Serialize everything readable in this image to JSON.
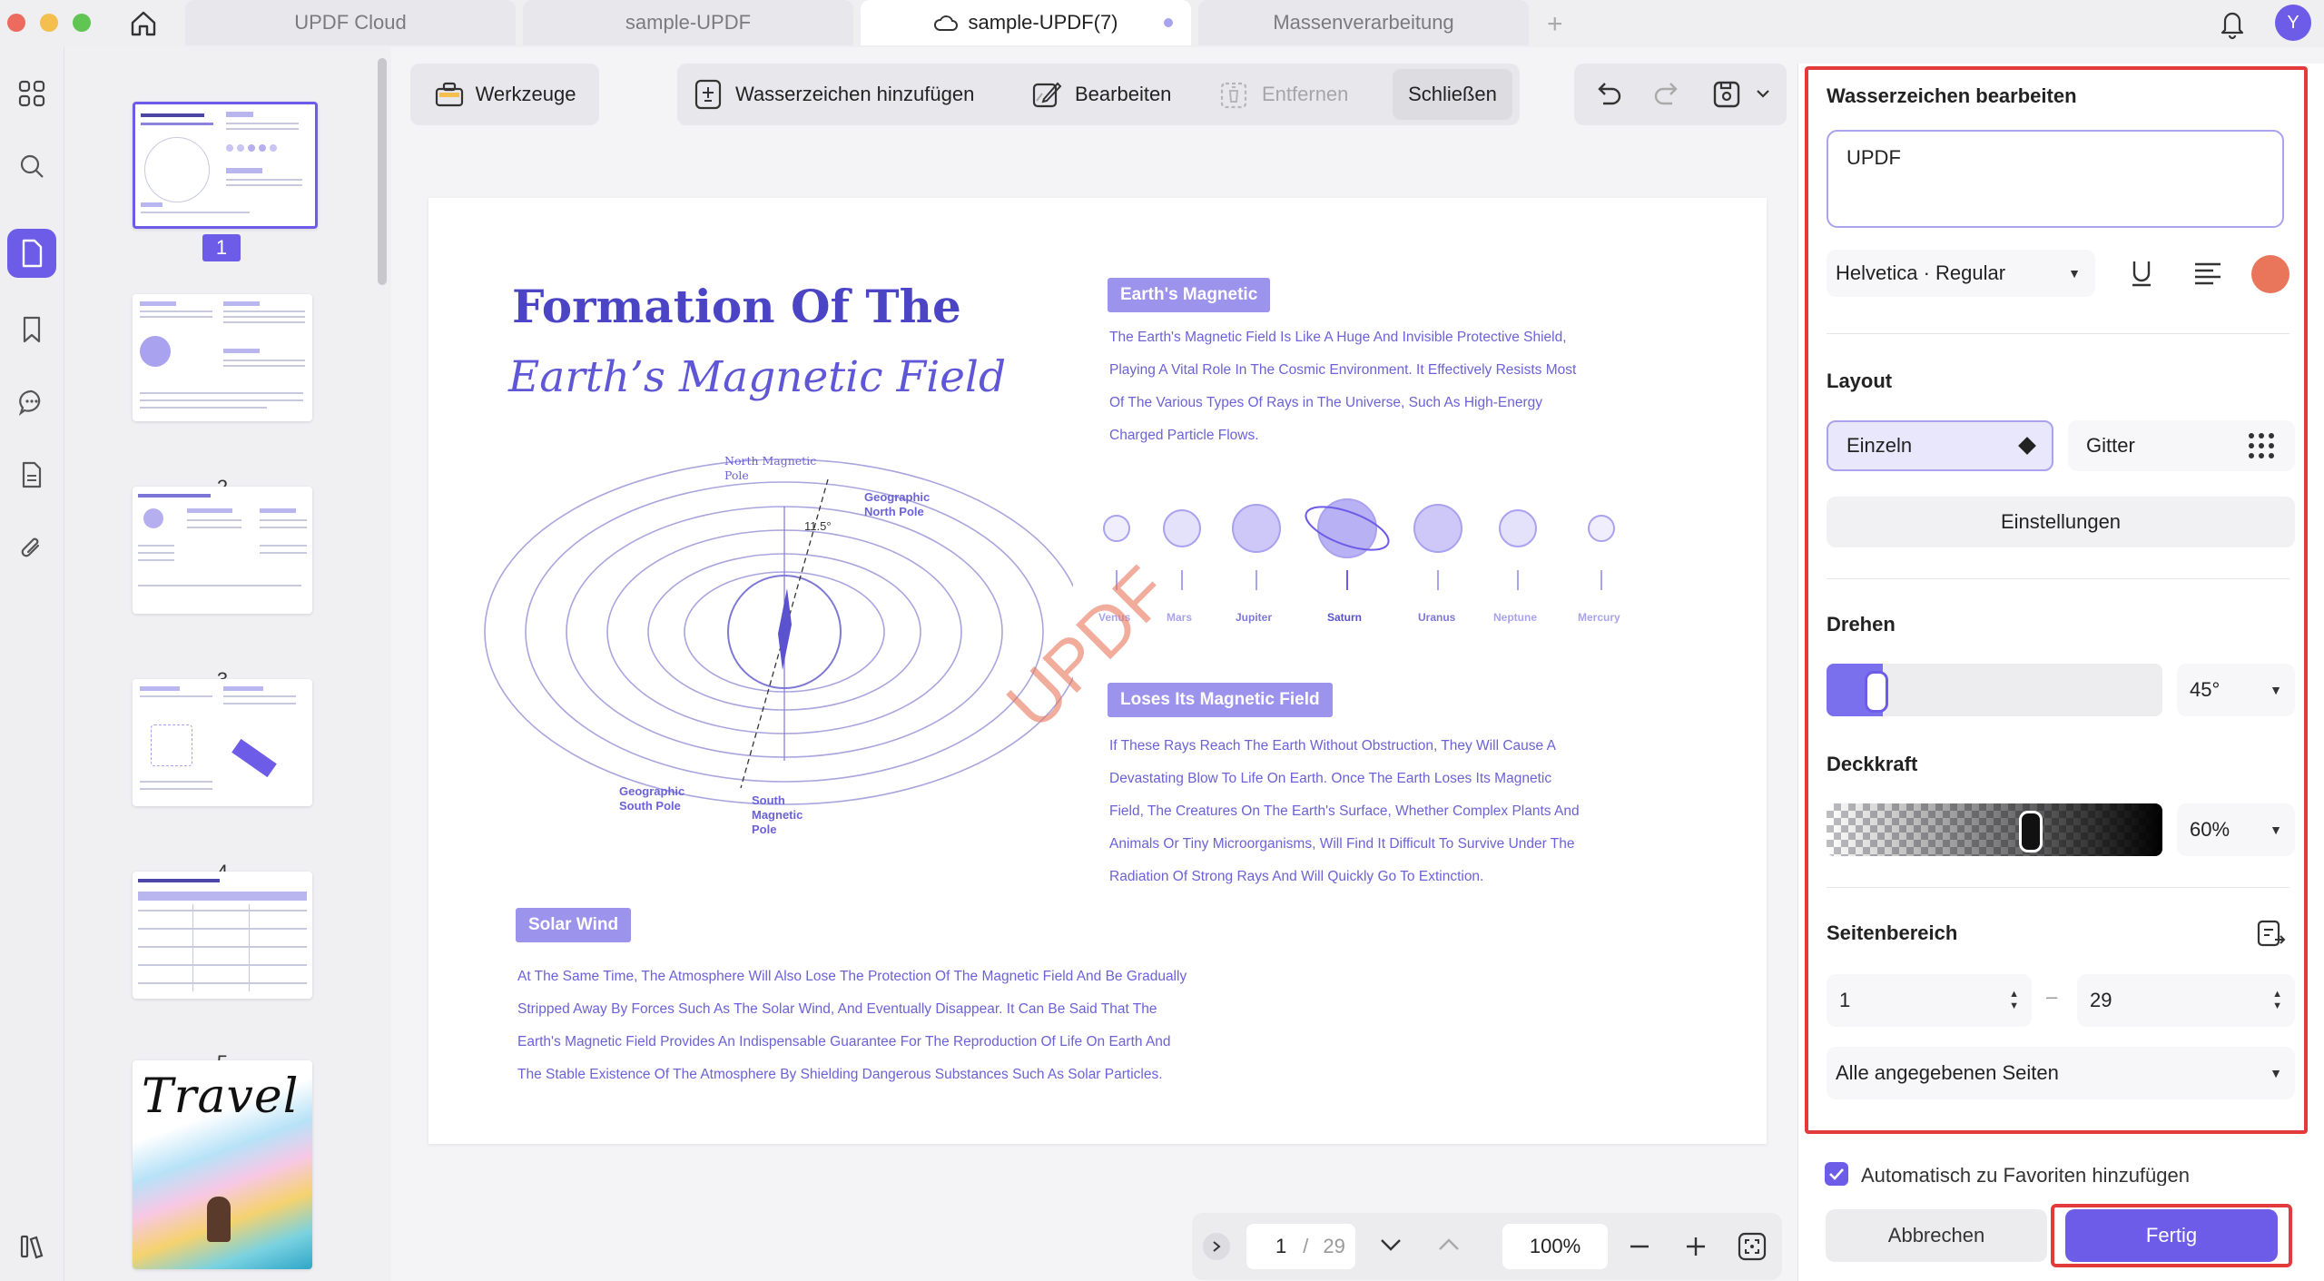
{
  "tabs": [
    {
      "label": "UPDF Cloud"
    },
    {
      "label": "sample-UPDF"
    },
    {
      "label": "sample-UPDF(7)"
    },
    {
      "label": "Massenverarbeitung"
    }
  ],
  "avatar_initial": "Y",
  "toolbar": {
    "werkzeuge": "Werkzeuge",
    "add_watermark": "Wasserzeichen hinzufügen",
    "edit": "Bearbeiten",
    "remove": "Entfernen",
    "close": "Schließen"
  },
  "thumbnails": {
    "page_numbers": [
      "1",
      "2",
      "3",
      "4",
      "5"
    ]
  },
  "document": {
    "title_line1": "Formation Of The",
    "title_line2": "Earth’s Magnetic Field",
    "section1_heading": "Earth's Magnetic",
    "section1_lines": [
      "The Earth's Magnetic Field Is Like A Huge And Invisible Protective Shield,",
      "Playing A Vital Role In The Cosmic Environment. It Effectively Resists Most",
      "Of The Various Types Of Rays in The Universe, Such As High-Energy",
      "Charged Particle Flows."
    ],
    "planets": [
      "Venus",
      "Mars",
      "Jupiter",
      "Saturn",
      "Uranus",
      "Neptune",
      "Mercury"
    ],
    "diagram_labels": {
      "north_magnetic": "North Magnetic Pole",
      "geo_north": "Geographic North Pole",
      "geo_south": "Geographic South Pole",
      "south_magnetic": "South Magnetic Pole",
      "angle": "11.5°"
    },
    "section2_heading": "Loses Its Magnetic Field",
    "section2_lines": [
      "If These Rays Reach The Earth Without Obstruction, They Will Cause A",
      "Devastating Blow To Life On Earth. Once The Earth Loses Its Magnetic",
      "Field, The Creatures On The Earth's Surface, Whether Complex Plants And",
      "Animals Or Tiny Microorganisms, Will Find It Difficult To Survive Under The",
      "Radiation Of Strong Rays And Will Quickly Go To Extinction."
    ],
    "section3_heading": "Solar Wind",
    "section3_lines": [
      "At The Same Time, The Atmosphere Will Also Lose The Protection Of The Magnetic Field And Be Gradually",
      "Stripped Away By Forces Such As The Solar Wind, And Eventually Disappear. It Can Be Said That The",
      "Earth's Magnetic Field Provides An Indispensable Guarantee For The Reproduction Of Life On Earth And",
      "The Stable Existence Of The Atmosphere By Shielding Dangerous Substances Such As Solar Particles."
    ],
    "watermark_text": "UPDF"
  },
  "panel": {
    "title": "Wasserzeichen bearbeiten",
    "text_value": "UPDF",
    "font": "Helvetica · Regular",
    "color": "#e9765b",
    "layout_label": "Layout",
    "layout_single": "Einzeln",
    "layout_grid": "Gitter",
    "settings_button": "Einstellungen",
    "rotate_label": "Drehen",
    "rotate_value": "45°",
    "opacity_label": "Deckkraft",
    "opacity_value": "60%",
    "range_label": "Seitenbereich",
    "range_from": "1",
    "range_to": "29",
    "range_dash": "–",
    "pages_option": "Alle angegebenen Seiten",
    "auto_favorites": "Automatisch zu Favoriten hinzufügen",
    "cancel": "Abbrechen",
    "done": "Fertig"
  },
  "bottom_nav": {
    "current_page": "1",
    "separator": "/",
    "total_pages": "29",
    "zoom": "100%"
  },
  "colors": {
    "accent": "#6c5ce7",
    "doc_text": "#6b62d6",
    "highlight": "#e33b3b",
    "watermark": "#e9765b"
  }
}
